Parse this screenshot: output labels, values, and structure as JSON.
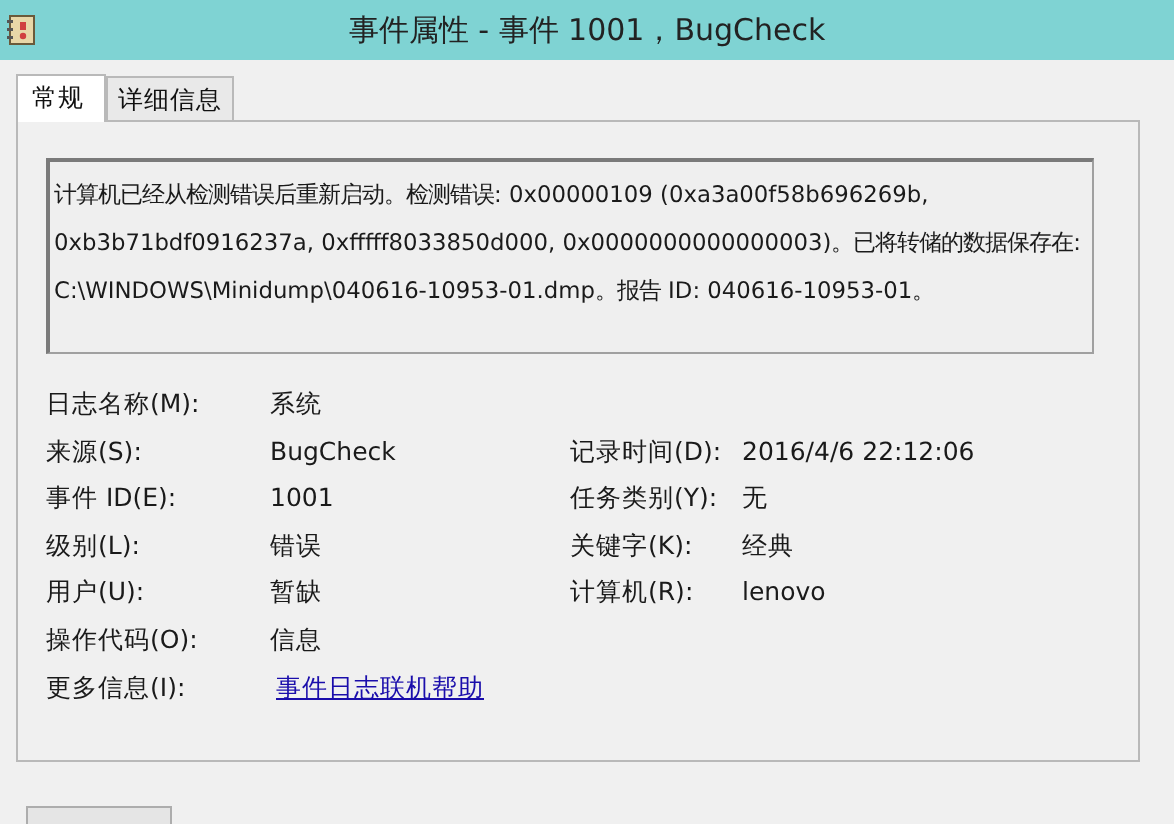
{
  "window": {
    "title": "事件属性 - 事件 1001，BugCheck"
  },
  "tabs": [
    {
      "label": "常规",
      "selected": true
    },
    {
      "label": "详细信息",
      "selected": false
    }
  ],
  "description": "计算机已经从检测错误后重新启动。检测错误: 0x00000109 (0xa3a00f58b696269b, 0xb3b71bdf0916237a, 0xfffff8033850d000, 0x0000000000000003)。已将转储的数据保存在: C:\\WINDOWS\\Minidump\\040616-10953-01.dmp。报告 ID: 040616-10953-01。",
  "rows": [
    [
      {
        "label": "日志名称(M):",
        "value": "系统",
        "kind": "text"
      }
    ],
    [
      {
        "label": "来源(S):",
        "value": "BugCheck",
        "kind": "text"
      },
      {
        "label": "记录时间(D):",
        "value": "2016/4/6 22:12:06",
        "kind": "text"
      }
    ],
    [
      {
        "label": "事件 ID(E):",
        "value": "1001",
        "kind": "text"
      },
      {
        "label": "任务类别(Y):",
        "value": "无",
        "kind": "text"
      }
    ],
    [
      {
        "label": "级别(L):",
        "value": "错误",
        "kind": "text"
      },
      {
        "label": "关键字(K):",
        "value": "经典",
        "kind": "text"
      }
    ],
    [
      {
        "label": "用户(U):",
        "value": "暂缺",
        "kind": "text"
      },
      {
        "label": "计算机(R):",
        "value": "lenovo",
        "kind": "text"
      }
    ],
    [
      {
        "label": "操作代码(O):",
        "value": "信息",
        "kind": "text"
      }
    ],
    [
      {
        "label": "更多信息(I):",
        "value": "事件日志联机帮助",
        "kind": "link"
      }
    ]
  ]
}
